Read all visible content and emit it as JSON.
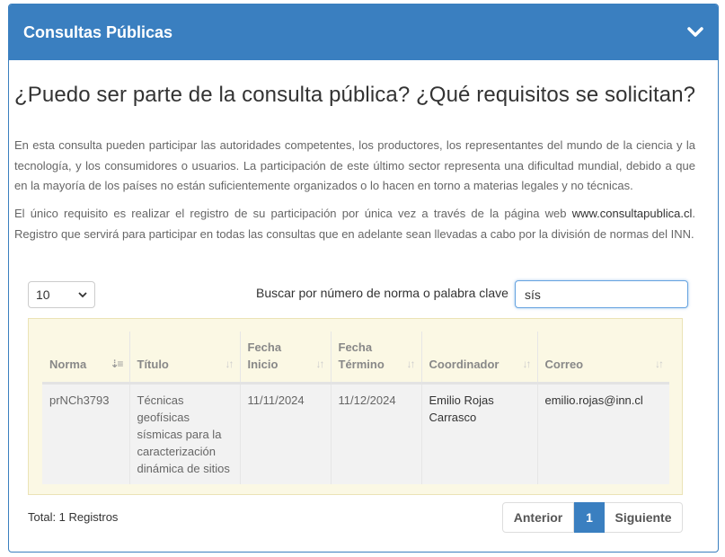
{
  "panel": {
    "title": "Consultas Públicas"
  },
  "content": {
    "heading": "¿Puedo ser parte de la consulta pública? ¿Qué requisitos se solicitan?",
    "paragraph1": "En esta consulta pueden participar las autoridades competentes, los productores, los representantes del mundo de la ciencia y la tecnología, y los consumidores o usuarios. La participación de este último sector representa una dificultad mundial, debido a que en la mayoría de los países no están suficientemente organizados o lo hacen en torno a materias legales y no técnicas.",
    "paragraph2_before": "El único requisito es realizar el registro de su participación por única vez a través de la página web ",
    "paragraph2_link": "www.consultapublica.cl",
    "paragraph2_after": ". Registro que servirá para participar en todas las consultas que en adelante sean llevadas a cabo por la división de normas del INN."
  },
  "controls": {
    "page_length": "10",
    "search_label": "Buscar por número de norma o palabra clave",
    "search_value": "sís"
  },
  "table": {
    "headers": {
      "norma": "Norma",
      "titulo": "Título",
      "fecha_inicio_1": "Fecha",
      "fecha_inicio_2": "Inicio",
      "fecha_termino_1": "Fecha",
      "fecha_termino_2": "Término",
      "coordinador": "Coordinador",
      "correo": "Correo"
    },
    "rows": [
      {
        "norma": "prNCh3793",
        "titulo": "Técnicas geofísicas sísmicas para la caracterización dinámica de sitios",
        "fecha_inicio": "11/11/2024",
        "fecha_termino": "11/12/2024",
        "coordinador": "Emilio Rojas Carrasco",
        "correo": "emilio.rojas@inn.cl"
      }
    ]
  },
  "footer": {
    "total": "Total: 1 Registros",
    "prev": "Anterior",
    "page": "1",
    "next": "Siguiente"
  },
  "colors": {
    "header_blue": "#3a7fc0",
    "table_bg": "#fbf8e4"
  }
}
